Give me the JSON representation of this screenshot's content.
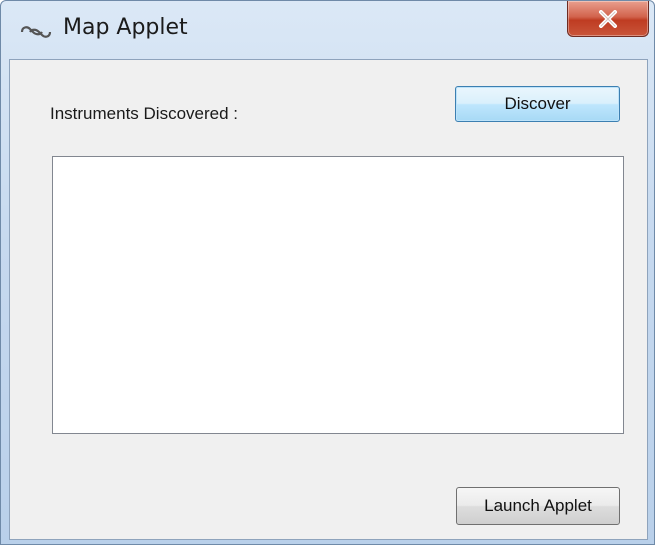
{
  "window": {
    "title": "Map Applet",
    "icon": "link-icon",
    "close_icon": "close-icon"
  },
  "content": {
    "instruments_label": "Instruments Discovered :",
    "discover_label": "Discover",
    "launch_label": "Launch Applet",
    "instruments": []
  },
  "colors": {
    "close_button": "#c9553a",
    "default_button_border": "#3c7fb1"
  }
}
